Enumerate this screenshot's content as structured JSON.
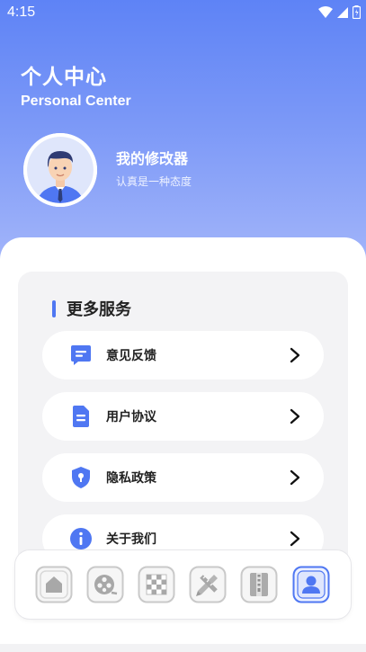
{
  "status_bar": {
    "time": "4:15"
  },
  "header": {
    "title": "个人中心",
    "subtitle": "Personal Center"
  },
  "profile": {
    "name": "我的修改器",
    "motto": "认真是一种态度",
    "avatar_icon": "user-avatar"
  },
  "services": {
    "title": "更多服务",
    "items": [
      {
        "label": "意见反馈",
        "icon": "feedback-icon"
      },
      {
        "label": "用户协议",
        "icon": "document-icon"
      },
      {
        "label": "隐私政策",
        "icon": "shield-icon"
      },
      {
        "label": "关于我们",
        "icon": "info-icon"
      }
    ]
  },
  "tab_bar": {
    "tabs": [
      {
        "icon": "home-icon",
        "active": false
      },
      {
        "icon": "film-reel-icon",
        "active": false
      },
      {
        "icon": "checker-grid-icon",
        "active": false
      },
      {
        "icon": "pencil-ruler-icon",
        "active": false
      },
      {
        "icon": "zip-file-icon",
        "active": false
      },
      {
        "icon": "profile-icon",
        "active": true
      }
    ]
  },
  "colors": {
    "accent": "#4f77f2",
    "header_top": "#5e83f6",
    "header_bottom": "#a4b6fa",
    "card_bg": "#f3f3f5"
  }
}
